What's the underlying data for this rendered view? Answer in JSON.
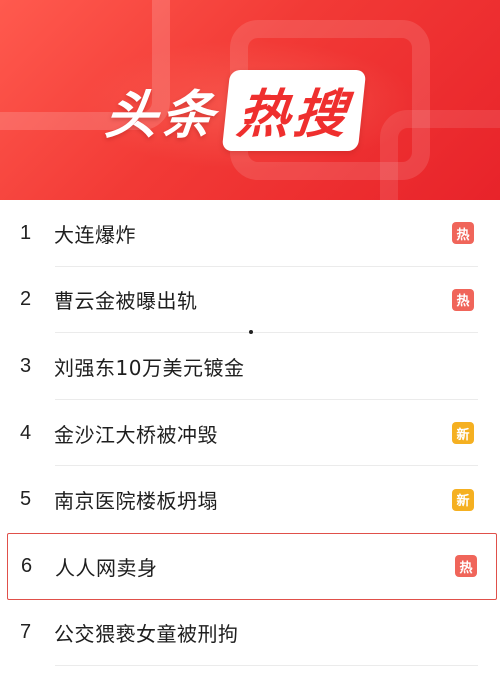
{
  "header": {
    "title_part1": "头条",
    "title_part2": "热搜"
  },
  "colors": {
    "banner_red": "#f23a36",
    "hot_badge": "#f0655a",
    "new_badge": "#f5b021",
    "highlight_border": "#e0504a"
  },
  "list": {
    "items": [
      {
        "rank": "1",
        "text": "大连爆炸",
        "badge": "热",
        "badge_type": "hot"
      },
      {
        "rank": "2",
        "text": "曹云金被曝出轨",
        "badge": "热",
        "badge_type": "hot"
      },
      {
        "rank": "3",
        "text": "刘强东10万美元镀金",
        "badge": "",
        "badge_type": "none"
      },
      {
        "rank": "4",
        "text": "金沙江大桥被冲毁",
        "badge": "新",
        "badge_type": "new"
      },
      {
        "rank": "5",
        "text": "南京医院楼板坍塌",
        "badge": "新",
        "badge_type": "new"
      },
      {
        "rank": "6",
        "text": "人人网卖身",
        "badge": "热",
        "badge_type": "hot",
        "highlighted": true
      },
      {
        "rank": "7",
        "text": "公交猥亵女童被刑拘",
        "badge": "",
        "badge_type": "none"
      }
    ]
  }
}
